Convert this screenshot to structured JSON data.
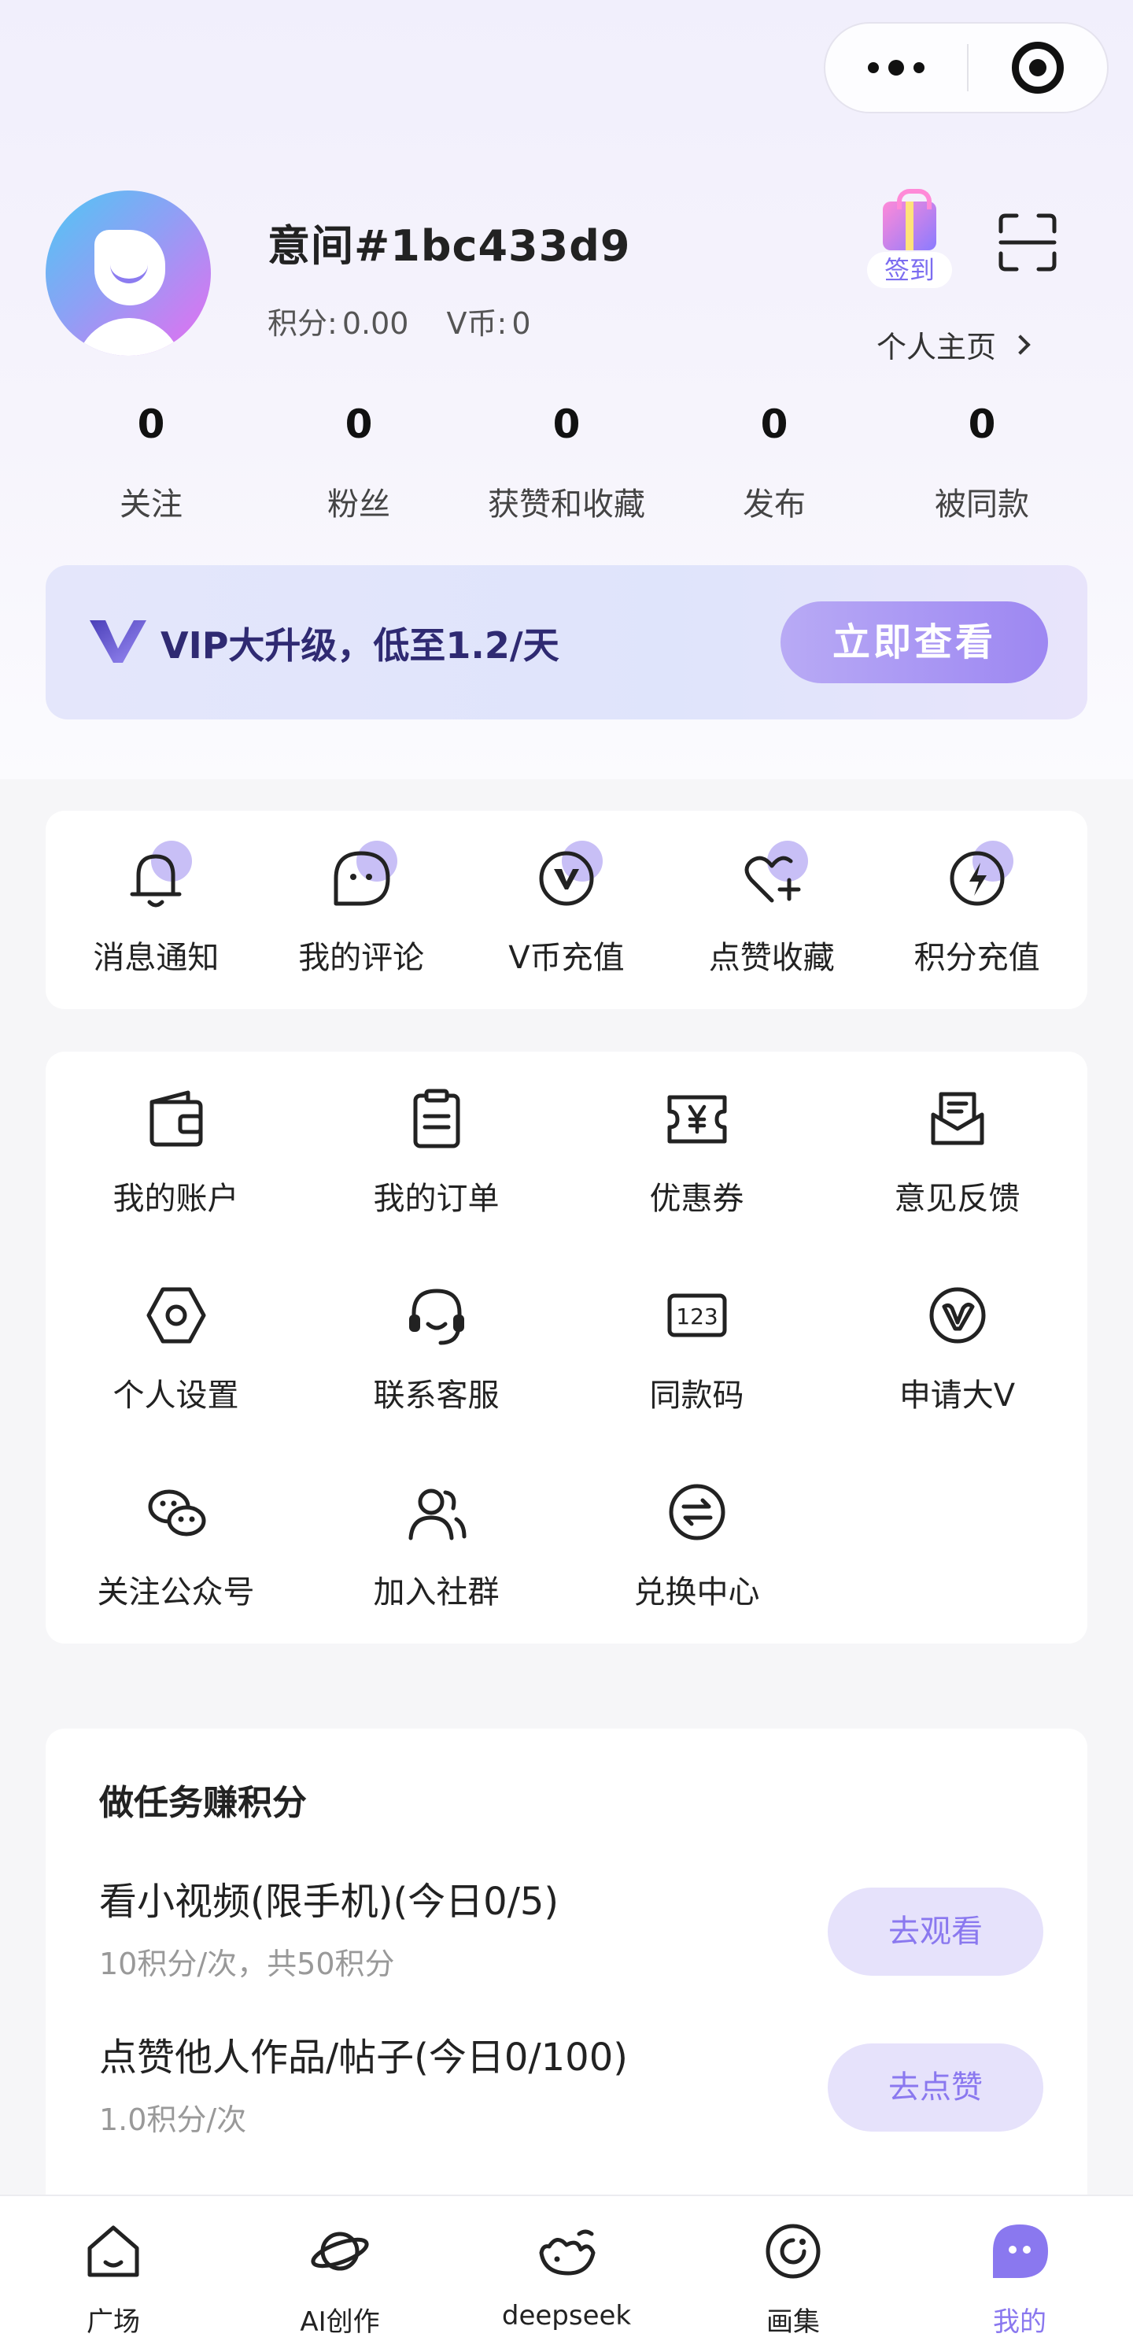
{
  "profile": {
    "username": "意间#1bc433d9",
    "points_label": "积分:",
    "points_value": "0.00",
    "vcoin_label": "V币:",
    "vcoin_value": "0",
    "checkin_label": "签到",
    "homepage_label": "个人主页"
  },
  "counters": [
    {
      "value": "0",
      "label": "关注"
    },
    {
      "value": "0",
      "label": "粉丝"
    },
    {
      "value": "0",
      "label": "获赞和收藏"
    },
    {
      "value": "0",
      "label": "发布"
    },
    {
      "value": "0",
      "label": "被同款"
    }
  ],
  "vip": {
    "text": "VIP大升级，低至1.2/天",
    "button": "立即查看"
  },
  "quick_actions": [
    {
      "label": "消息通知",
      "icon": "bell-icon"
    },
    {
      "label": "我的评论",
      "icon": "comment-icon"
    },
    {
      "label": "V币充值",
      "icon": "v-coin-icon"
    },
    {
      "label": "点赞收藏",
      "icon": "heart-plus-icon"
    },
    {
      "label": "积分充值",
      "icon": "lightning-icon"
    }
  ],
  "services": [
    {
      "label": "我的账户",
      "icon": "wallet-icon"
    },
    {
      "label": "我的订单",
      "icon": "clipboard-icon"
    },
    {
      "label": "优惠券",
      "icon": "coupon-icon"
    },
    {
      "label": "意见反馈",
      "icon": "mail-icon"
    },
    {
      "label": "个人设置",
      "icon": "hexagon-settings-icon"
    },
    {
      "label": "联系客服",
      "icon": "headset-icon"
    },
    {
      "label": "同款码",
      "icon": "code-123-icon"
    },
    {
      "label": "申请大V",
      "icon": "big-v-icon"
    },
    {
      "label": "关注公众号",
      "icon": "wechat-icon"
    },
    {
      "label": "加入社群",
      "icon": "group-icon"
    },
    {
      "label": "兑换中心",
      "icon": "exchange-icon"
    }
  ],
  "tasks": {
    "title": "做任务赚积分",
    "items": [
      {
        "name": "看小视频(限手机)(今日0/5)",
        "sub": "10积分/次，共50积分",
        "button": "去观看"
      },
      {
        "name": "点赞他人作品/帖子(今日0/100)",
        "sub": "1.0积分/次",
        "button": "去点赞"
      }
    ]
  },
  "tabbar": [
    {
      "label": "广场",
      "icon": "home-icon"
    },
    {
      "label": "AI创作",
      "icon": "planet-icon"
    },
    {
      "label": "deepseek",
      "icon": "whale-icon"
    },
    {
      "label": "画集",
      "icon": "gallery-icon"
    },
    {
      "label": "我的",
      "icon": "mine-chat-icon"
    }
  ],
  "colors": {
    "accent": "#8a78ef",
    "vip_text": "#2f2a72"
  }
}
